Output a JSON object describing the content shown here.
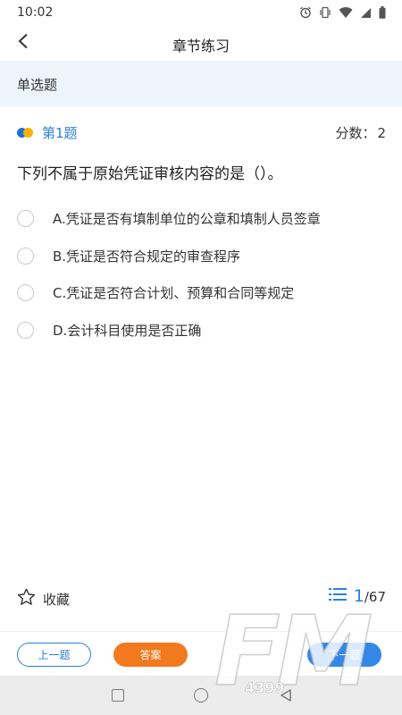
{
  "status_bar": {
    "time": "10:02",
    "icons": [
      "alarm-icon",
      "vibrate-icon",
      "wifi-icon",
      "signal-icon",
      "battery-icon"
    ]
  },
  "header": {
    "title": "章节练习",
    "back_icon": "chevron-left-icon"
  },
  "section": {
    "label": "单选题"
  },
  "question": {
    "number_label": "第1题",
    "score_label": "分数：",
    "score_value": "2",
    "text": "下列不属于原始凭证审核内容的是（）。",
    "options": [
      {
        "label": "A.凭证是否有填制单位的公章和填制人员签章"
      },
      {
        "label": "B.凭证是否符合规定的审查程序"
      },
      {
        "label": "C.凭证是否符合计划、预算和合同等规定"
      },
      {
        "label": "D.会计科目使用是否正确"
      }
    ]
  },
  "tools": {
    "favorite_label": "收藏",
    "favorite_icon": "star-icon",
    "list_icon": "list-icon",
    "progress_current": "1",
    "progress_total": "/67"
  },
  "actions": {
    "prev_label": "上一题",
    "answer_label": "答案",
    "next_label": "下一题"
  },
  "watermark": {
    "text": "FM",
    "sub": "4399"
  },
  "colors": {
    "accent_blue": "#2b7fdc",
    "answer_orange": "#f3791f",
    "banner_bg": "#edf4fc"
  }
}
